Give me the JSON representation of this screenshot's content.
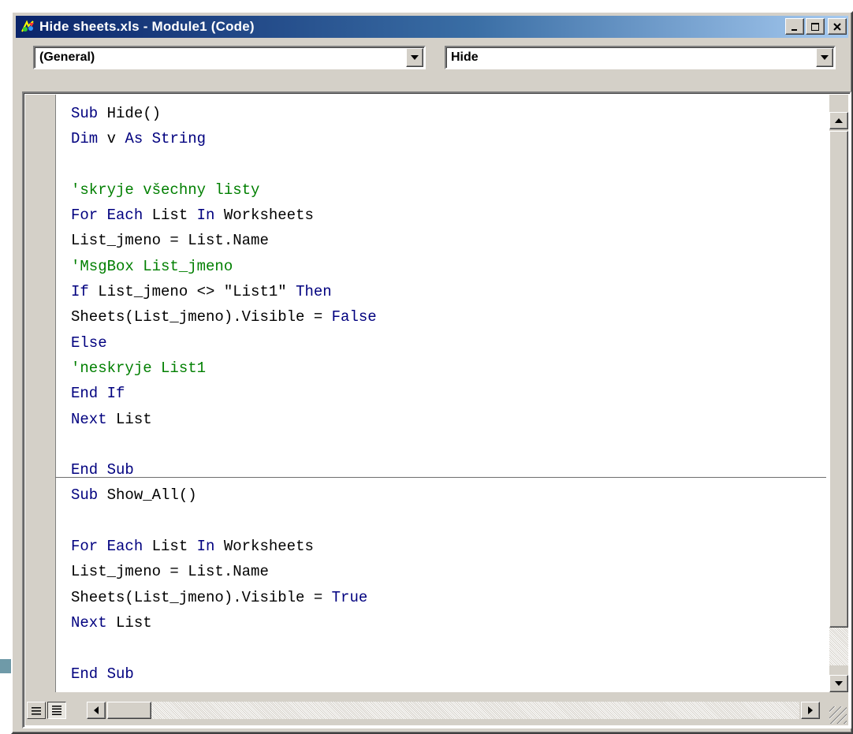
{
  "window": {
    "title": "Hide sheets.xls - Module1 (Code)",
    "buttons": {
      "minimize_icon": "minimize-icon",
      "maximize_icon": "maximize-icon",
      "close_icon": "close-icon"
    }
  },
  "combos": {
    "object_value": "(General)",
    "procedure_value": "Hide"
  },
  "code_lines": [
    [
      {
        "t": "kw",
        "s": "Sub"
      },
      {
        "t": "n",
        "s": " Hide()"
      }
    ],
    [
      {
        "t": "kw",
        "s": "Dim"
      },
      {
        "t": "n",
        "s": " v "
      },
      {
        "t": "kw",
        "s": "As String"
      }
    ],
    [],
    [
      {
        "t": "cm",
        "s": "'skryje všechny listy"
      }
    ],
    [
      {
        "t": "kw",
        "s": "For Each"
      },
      {
        "t": "n",
        "s": " List "
      },
      {
        "t": "kw",
        "s": "In"
      },
      {
        "t": "n",
        "s": " Worksheets"
      }
    ],
    [
      {
        "t": "n",
        "s": "List_jmeno = List.Name"
      }
    ],
    [
      {
        "t": "cm",
        "s": "'MsgBox List_jmeno"
      }
    ],
    [
      {
        "t": "kw",
        "s": "If"
      },
      {
        "t": "n",
        "s": " List_jmeno <> \"List1\" "
      },
      {
        "t": "kw",
        "s": "Then"
      }
    ],
    [
      {
        "t": "n",
        "s": "Sheets(List_jmeno).Visible = "
      },
      {
        "t": "kw",
        "s": "False"
      }
    ],
    [
      {
        "t": "kw",
        "s": "Else"
      }
    ],
    [
      {
        "t": "cm",
        "s": "'neskryje List1"
      }
    ],
    [
      {
        "t": "kw",
        "s": "End If"
      }
    ],
    [
      {
        "t": "kw",
        "s": "Next"
      },
      {
        "t": "n",
        "s": " List"
      }
    ],
    [],
    [
      {
        "t": "kw",
        "s": "End Sub"
      }
    ],
    [
      {
        "t": "kw",
        "s": "Sub"
      },
      {
        "t": "n",
        "s": " Show_All()"
      }
    ],
    [],
    [
      {
        "t": "kw",
        "s": "For Each"
      },
      {
        "t": "n",
        "s": " List "
      },
      {
        "t": "kw",
        "s": "In"
      },
      {
        "t": "n",
        "s": " Worksheets"
      }
    ],
    [
      {
        "t": "n",
        "s": "List_jmeno = List.Name"
      }
    ],
    [
      {
        "t": "n",
        "s": "Sheets(List_jmeno).Visible = "
      },
      {
        "t": "kw",
        "s": "True"
      }
    ],
    [
      {
        "t": "kw",
        "s": "Next"
      },
      {
        "t": "n",
        "s": " List"
      }
    ],
    [],
    [
      {
        "t": "kw",
        "s": "End Sub"
      }
    ]
  ],
  "colors": {
    "keyword": "#00007f",
    "comment": "#007f00",
    "titlebar_start": "#0a246a",
    "titlebar_end": "#a6caf0",
    "chrome": "#d4d0c8"
  },
  "icons": {
    "app_icon": "vba-module-icon",
    "procedure_view": "procedure-view-icon",
    "full_module_view": "full-module-view-icon"
  }
}
